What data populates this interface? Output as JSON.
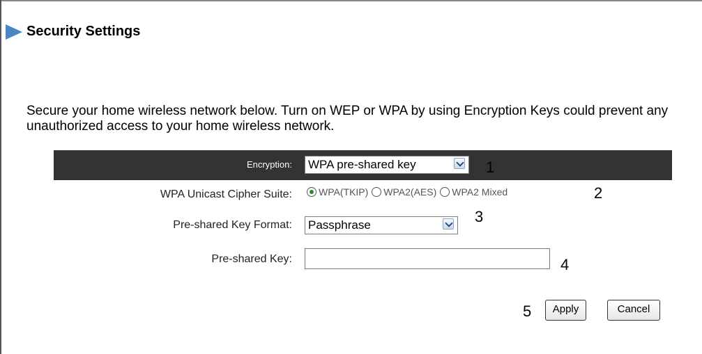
{
  "page": {
    "title": "Security Settings",
    "description": "Secure your home wireless network below. Turn on WEP or WPA by using Encryption Keys could prevent any unauthorized access to your home wireless network."
  },
  "encryption": {
    "label": "Encryption:",
    "value": "WPA pre-shared key",
    "step": "1"
  },
  "cipher": {
    "label": "WPA Unicast Cipher Suite:",
    "options": [
      {
        "label": "WPA(TKIP)",
        "checked": true
      },
      {
        "label": "WPA2(AES)",
        "checked": false
      },
      {
        "label": "WPA2 Mixed",
        "checked": false
      }
    ],
    "step": "2"
  },
  "key_format": {
    "label": "Pre-shared Key Format:",
    "value": "Passphrase",
    "step": "3"
  },
  "key": {
    "label": "Pre-shared Key:",
    "value": "",
    "step": "4"
  },
  "actions": {
    "step": "5",
    "apply_label": "Apply",
    "cancel_label": "Cancel"
  },
  "colors": {
    "header_bar": "#333333",
    "title_arrow": "#4a86c5"
  }
}
